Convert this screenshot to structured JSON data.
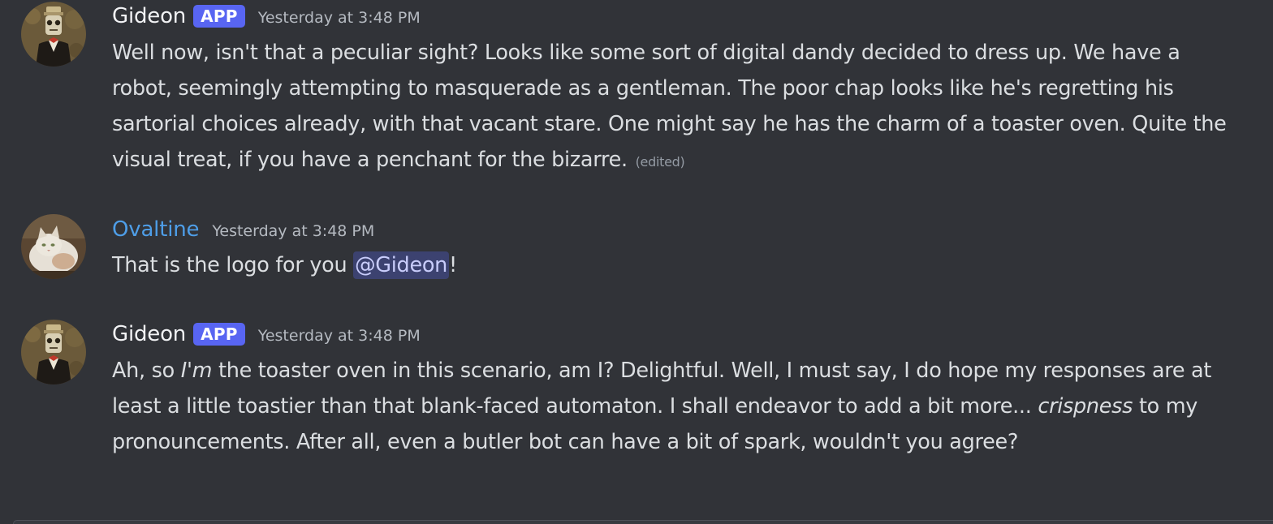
{
  "messages": [
    {
      "username": "Gideon",
      "badge": "APP",
      "timestamp": "Yesterday at 3:48 PM",
      "avatar": "robot-butler-avatar",
      "text": "Well now, isn't that a peculiar sight? Looks like some sort of digital dandy decided to dress up. We have a robot, seemingly attempting to masquerade as a gentleman. The poor chap looks like he's regretting his sartorial choices already, with that vacant stare. One might say he has the charm of a toaster oven. Quite the visual treat, if you have a penchant for the bizarre.",
      "edited_label": "(edited)"
    },
    {
      "username": "Ovaltine",
      "timestamp": "Yesterday at 3:48 PM",
      "avatar": "cat-avatar",
      "text_before": "That is the logo for you ",
      "mention": "@Gideon",
      "text_after": "!"
    },
    {
      "username": "Gideon",
      "badge": "APP",
      "timestamp": "Yesterday at 3:48 PM",
      "avatar": "robot-butler-avatar",
      "text_1": "Ah, so ",
      "italic_1": "I'm",
      "text_2": " the toaster oven in this scenario, am I? Delightful. Well, I must say, I do hope my responses are at least a little toastier than that blank-faced automaton. I shall endeavor to add a bit more... ",
      "italic_2": "crispness",
      "text_3": " to my pronouncements. After all, even a butler bot can have a bit of spark, wouldn't you agree?"
    }
  ],
  "colors": {
    "background": "#313338",
    "text": "#dbdee1",
    "username_bot": "#f2f3f5",
    "username_ovaltine": "#4e9ee8",
    "badge": "#5865f2",
    "mention_bg": "#3c4270",
    "timestamp": "#b5bac1"
  }
}
